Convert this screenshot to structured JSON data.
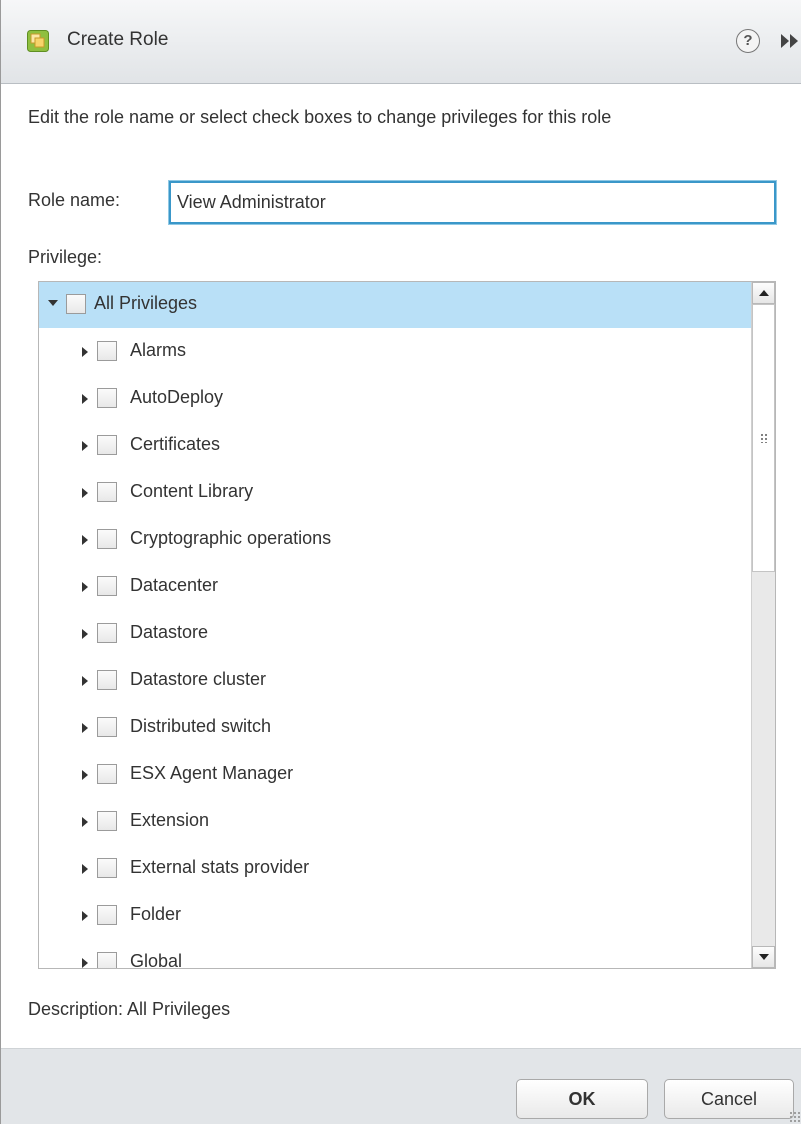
{
  "dialog": {
    "title": "Create Role",
    "help_symbol": "?",
    "instructions": "Edit the role name or select check boxes to change privileges for this role",
    "role_name_label": "Role name:",
    "role_name_value": "View Administrator",
    "privilege_label": "Privilege:",
    "description_text": "Description:  All Privileges",
    "ok_label": "OK",
    "cancel_label": "Cancel"
  },
  "tree": {
    "root": {
      "label": "All Privileges",
      "expanded": true,
      "selected": true,
      "checked": false
    },
    "items": [
      {
        "label": "Alarms",
        "checked": false
      },
      {
        "label": "AutoDeploy",
        "checked": false
      },
      {
        "label": "Certificates",
        "checked": false
      },
      {
        "label": "Content Library",
        "checked": false
      },
      {
        "label": "Cryptographic operations",
        "checked": false
      },
      {
        "label": "Datacenter",
        "checked": false
      },
      {
        "label": "Datastore",
        "checked": false
      },
      {
        "label": "Datastore cluster",
        "checked": false
      },
      {
        "label": "Distributed switch",
        "checked": false
      },
      {
        "label": "ESX Agent Manager",
        "checked": false
      },
      {
        "label": "Extension",
        "checked": false
      },
      {
        "label": "External stats provider",
        "checked": false
      },
      {
        "label": "Folder",
        "checked": false
      },
      {
        "label": "Global",
        "checked": false
      }
    ]
  },
  "colors": {
    "selection": "#b9e0f7",
    "input_focus_border": "#3a97c9",
    "footer_bg": "#e2e5e8"
  },
  "icons": {
    "app": "vsphere-app-icon",
    "help": "help-icon",
    "expand": "double-chevron-right-icon"
  }
}
